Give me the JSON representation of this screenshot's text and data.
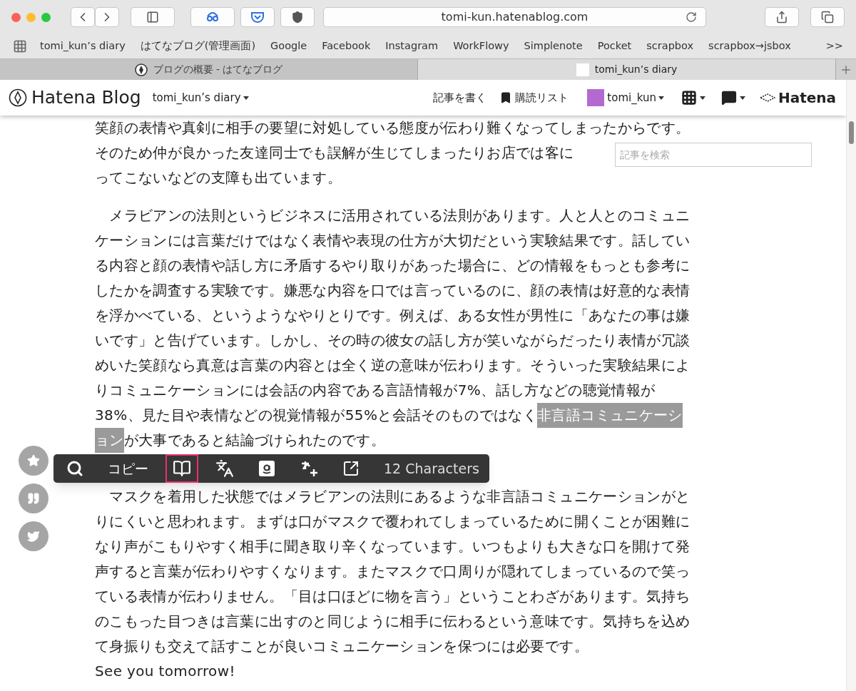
{
  "browser": {
    "url": "tomi-kun.hatenablog.com",
    "bookmarks": [
      "tomi_kun’s diary",
      "はてなブログ(管理画面)",
      "Google",
      "Facebook",
      "Instagram",
      "WorkFlowy",
      "Simplenote",
      "Pocket",
      "scrapbox",
      "scrapbox→jsbox"
    ],
    "overflow": ">>",
    "tabs": [
      {
        "title": "ブログの概要 - はてなブログ",
        "selected": false
      },
      {
        "title": "tomi_kun’s diary",
        "selected": true
      }
    ]
  },
  "blog_header": {
    "logo": "Hatena Blog",
    "blog_name": "tomi_kun’s diary",
    "write": "記事を書く",
    "subscriptions": "購読リスト",
    "user": "tomi_kun",
    "brand": "Hatena"
  },
  "search": {
    "placeholder": "記事を検索"
  },
  "article": {
    "paragraphs": [
      [
        "笑顔の表情や真剣に相手の要望に対処している態度が伝わり難くなってしまったからです。",
        "そのため仲が良かった友達同士でも誤解が生じてしまったりお店では客に",
        "ってこないなどの支障も出ています。"
      ],
      [
        "　メラビアンの法則というビジネスに活用されている法則があります。人と人とのコミュニ",
        "ケーションには言葉だけではなく表情や表現の仕方が大切だという実験結果です。話してい",
        "る内容と顔の表情や話し方に矛盾するやり取りがあった場合に、どの情報をもっとも参考に",
        "したかを調査する実験です。嫌悪な内容を口では言っているのに、顔の表情は好意的な表情",
        "を浮かべている、というようなやりとりです。例えば、ある女性が男性に「あなたの事は嫌",
        "いです」と告げています。しかし、その時の彼女の話し方が笑いながらだったり表情が冗談",
        "めいた笑顔なら真意は言葉の内容とは全く逆の意味が伝わります。そういった実験結果によ",
        "りコミュニケーションには会話の内容である言語情報が7%、話し方などの聴覚情報が",
        {
          "parts": [
            {
              "text": "38%、見た目や表情などの視覚情報が55%と会話そのものではなく",
              "selected": false
            },
            {
              "text": "非言語コミュニケーシ",
              "selected": true
            }
          ]
        },
        {
          "parts": [
            {
              "text": "ョン",
              "selected": true
            },
            {
              "text": "が大事であると結論づけられたのです。",
              "selected": false
            }
          ]
        }
      ],
      [
        "　マスクを着用した状態ではメラビアンの法則にあるような非言語コミュニケーションがと",
        "りにくいと思われます。まずは口がマスクで覆われてしまっているために開くことが困難に",
        "なり声がこもりやすく相手に聞き取り辛くなっています。いつもよりも大きな口を開けて発",
        "声すると言葉が伝わりやすくなります。またマスクで口周りが隠れてしまっているので笑っ",
        "ている表情が伝わりません。「目は口ほどに物を言う」ということわざがあります。気持ち",
        "のこもった目つきは言葉に出すのと同じように相手に伝わるという意味です。気持ちを込め",
        "て身振りも交えて話すことが良いコミュニケーションを保つには必要です。",
        "See you tomorrow!"
      ]
    ]
  },
  "share_buttons": [
    {
      "kind": "star"
    },
    {
      "kind": "quote"
    },
    {
      "kind": "twitter"
    }
  ],
  "selection_toolbar": {
    "items": [
      {
        "kind": "search",
        "selected": false
      },
      {
        "kind": "text",
        "label": "コピー",
        "selected": false
      },
      {
        "kind": "dictionary",
        "selected": true
      },
      {
        "kind": "translate",
        "selected": false
      },
      {
        "kind": "amazon",
        "selected": false
      },
      {
        "kind": "add",
        "selected": false
      },
      {
        "kind": "window",
        "selected": false
      }
    ],
    "count": "12 Characters"
  }
}
